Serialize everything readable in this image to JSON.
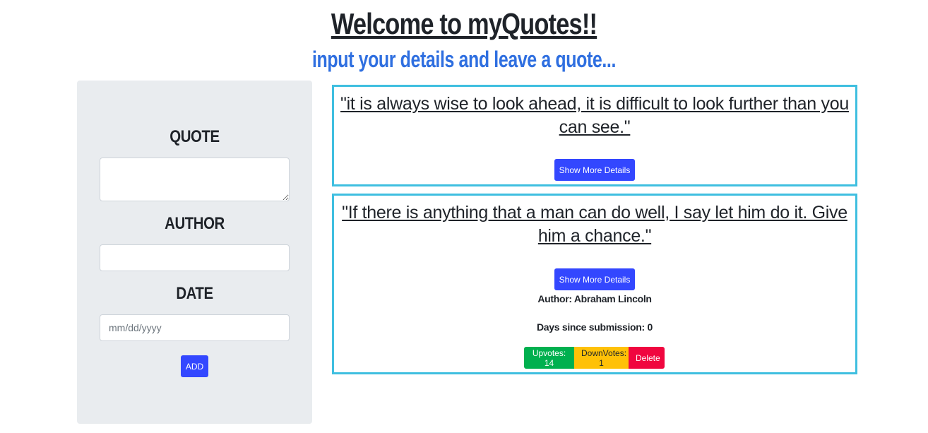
{
  "header": {
    "title": "Welcome to myQuotes!!",
    "subtitle": "input your details and leave a quote..."
  },
  "form": {
    "quote_label": "QUOTE",
    "author_label": "AUTHOR",
    "date_label": "DATE",
    "quote_value": "",
    "author_value": "",
    "date_placeholder": "mm/dd/yyyy",
    "add_label": "ADD"
  },
  "quotes": [
    {
      "text": "\"it is always wise to look ahead, it is difficult to look further than you can see.\"",
      "details_label": "Show More Details"
    },
    {
      "text": "\"If there is anything that a man can do well, I say let him do it. Give him a chance.\"",
      "details_label": "Show More Details",
      "author_line": "Author: Abraham Lincoln",
      "days_line": "Days since submission: 0",
      "upvotes_label": "Upvotes: 14",
      "downvotes_label": "DownVotes: 1",
      "delete_label": "Delete"
    }
  ],
  "colors": {
    "primary": "#3347ff",
    "success": "#00b04f",
    "warning": "#ffc107",
    "danger": "#f0063f",
    "card_border": "#3fbfe0",
    "subtitle": "#2f6fe0",
    "panel_bg": "#e9ecef"
  }
}
